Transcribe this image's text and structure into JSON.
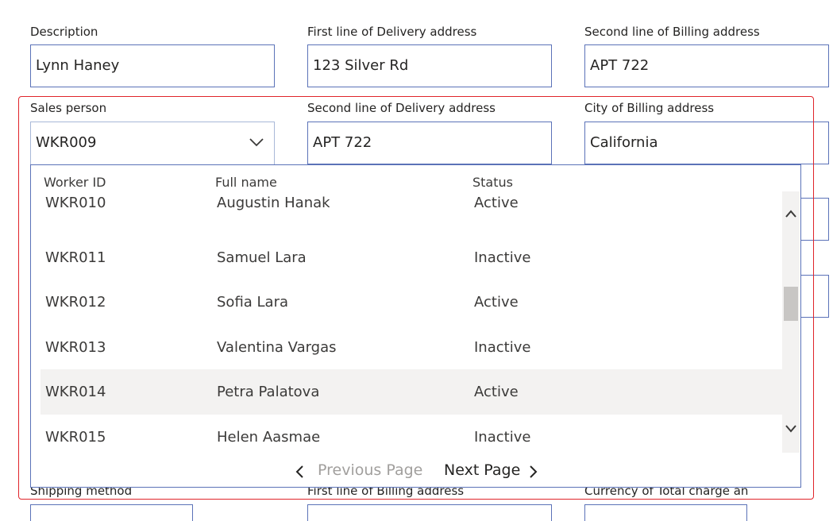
{
  "form": {
    "description": {
      "label": "Description",
      "value": "Lynn Haney"
    },
    "delivery_line1": {
      "label": "First line of Delivery address",
      "value": "123 Silver Rd"
    },
    "billing_line2": {
      "label": "Second line of Billing address",
      "value": "APT 722"
    },
    "sales_person": {
      "label": "Sales person",
      "value": "WKR009"
    },
    "delivery_line2": {
      "label": "Second line of Delivery address",
      "value": "APT 722"
    },
    "billing_city": {
      "label": "City of Billing address",
      "value": "California"
    },
    "shipping_method": {
      "label": "Shipping method"
    },
    "billing_line1": {
      "label": "First line of Billing address"
    },
    "currency": {
      "label": "Currency of Total charge an"
    }
  },
  "dropdown": {
    "columns": [
      "Worker ID",
      "Full name",
      "Status"
    ],
    "rows": [
      {
        "id": "WKR010",
        "name": "Augustin Hanak",
        "status": "Active"
      },
      {
        "id": "WKR011",
        "name": "Samuel Lara",
        "status": "Inactive"
      },
      {
        "id": "WKR012",
        "name": "Sofia Lara",
        "status": "Active"
      },
      {
        "id": "WKR013",
        "name": "Valentina Vargas",
        "status": "Inactive"
      },
      {
        "id": "WKR014",
        "name": "Petra Palatova",
        "status": "Active"
      },
      {
        "id": "WKR015",
        "name": "Helen Aasmae",
        "status": "Inactive"
      }
    ],
    "hovered_row": "WKR014",
    "pager": {
      "previous": "Previous Page",
      "next": "Next Page"
    }
  },
  "icons": {
    "combo": "chevron-down-icon",
    "scroll_up": "chevron-up-icon",
    "scroll_down": "chevron-down-icon",
    "prev": "chevron-left-icon",
    "next": "chevron-right-icon"
  },
  "colors": {
    "input_border": "#5b72b8",
    "highlight": "#e0242a",
    "hover_row": "#f3f2f1",
    "disabled_text": "#a19f9d"
  }
}
